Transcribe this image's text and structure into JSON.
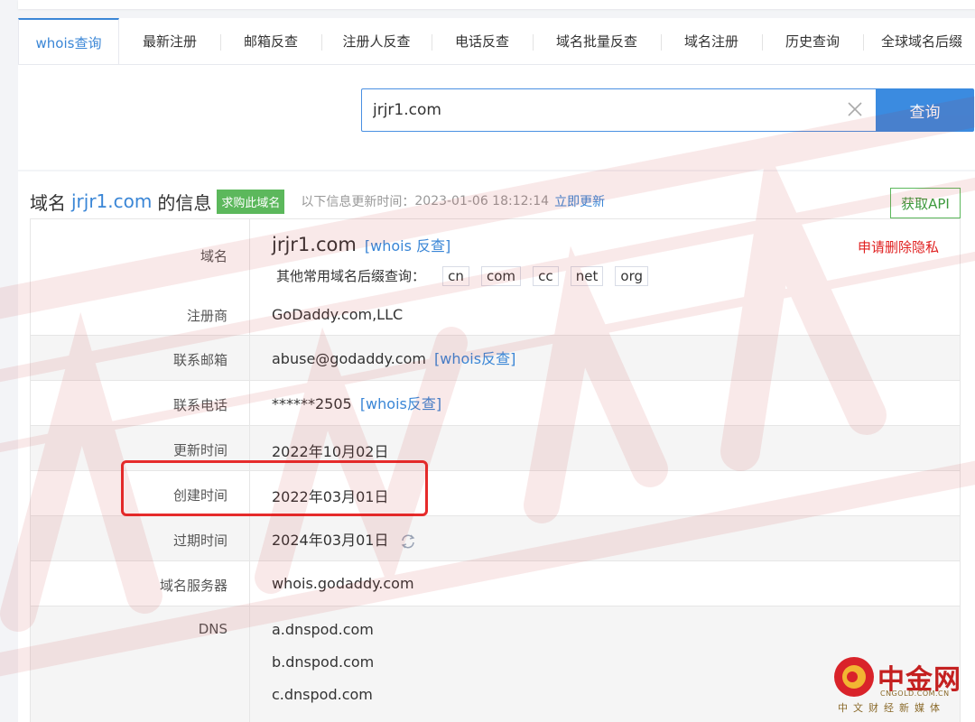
{
  "tabs": [
    {
      "label": "whois查询",
      "active": true
    },
    {
      "label": "最新注册"
    },
    {
      "label": "邮箱反查"
    },
    {
      "label": "注册人反查"
    },
    {
      "label": "电话反查"
    },
    {
      "label": "域名批量反查"
    },
    {
      "label": "域名注册"
    },
    {
      "label": "历史查询"
    },
    {
      "label": "全球域名后缀"
    }
  ],
  "search": {
    "value": "jrjr1.com",
    "button_label": "查询"
  },
  "header": {
    "title_prefix": "域名",
    "domain": "jrjr1.com",
    "title_suffix": "的信息",
    "buy_label": "求购此域名",
    "update_label": "以下信息更新时间：",
    "update_time": "2023-01-06 18:12:14",
    "update_now": "立即更新",
    "api_label": "获取API"
  },
  "rows": {
    "domain": {
      "label": "域名",
      "value": "jrjr1.com",
      "link": "[whois 反查]",
      "privacy": "申请删除隐私"
    },
    "suffixes": {
      "label": "其他常用域名后缀查询：",
      "items": [
        "cn",
        "com",
        "cc",
        "net",
        "org"
      ]
    },
    "registrar": {
      "label": "注册商",
      "value": "GoDaddy.com,LLC"
    },
    "email": {
      "label": "联系邮箱",
      "value": "abuse@godaddy.com",
      "link": "[whois反查]"
    },
    "phone": {
      "label": "联系电话",
      "value": "******2505",
      "link": "[whois反查]"
    },
    "updated": {
      "label": "更新时间",
      "value": "2022年10月02日"
    },
    "created": {
      "label": "创建时间",
      "value": "2022年03月01日"
    },
    "expires": {
      "label": "过期时间",
      "value": "2024年03月01日"
    },
    "whois_server": {
      "label": "域名服务器",
      "value": "whois.godaddy.com"
    },
    "dns": {
      "label": "DNS",
      "values": [
        "a.dnspod.com",
        "b.dnspod.com",
        "c.dnspod.com"
      ]
    }
  },
  "logo": {
    "name": "中金网",
    "en": "CNGOLD.COM.CN",
    "tagline": "中文财经新媒体"
  },
  "colors": {
    "accent": "#3a86d6",
    "green": "#5cb85c",
    "red": "#e02020",
    "highlight": "#e62b2b"
  }
}
